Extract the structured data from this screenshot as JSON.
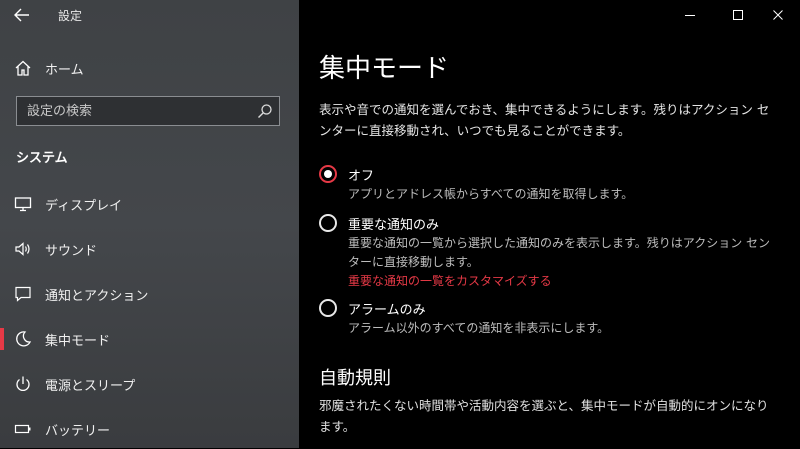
{
  "window": {
    "title": "設定",
    "controls": [
      "minimize",
      "maximize",
      "close"
    ]
  },
  "sidebar": {
    "home_label": "ホーム",
    "search_placeholder": "設定の検索",
    "section_title": "システム",
    "items": [
      {
        "label": "ディスプレイ",
        "icon": "monitor-icon"
      },
      {
        "label": "サウンド",
        "icon": "speaker-icon"
      },
      {
        "label": "通知とアクション",
        "icon": "notification-icon"
      },
      {
        "label": "集中モード",
        "icon": "moon-icon",
        "active": true
      },
      {
        "label": "電源とスリープ",
        "icon": "power-icon"
      },
      {
        "label": "バッテリー",
        "icon": "battery-icon"
      }
    ]
  },
  "main": {
    "title": "集中モード",
    "description": "表示や音での通知を選んでおき、集中できるようにします。残りはアクション センターに直接移動され、いつでも見ることができます。",
    "options": [
      {
        "label": "オフ",
        "sub": "アプリとアドレス帳からすべての通知を取得します。",
        "checked": true
      },
      {
        "label": "重要な通知のみ",
        "sub": "重要な通知の一覧から選択した通知のみを表示します。残りはアクション センターに直接移動します。",
        "link": "重要な通知の一覧をカスタマイズする",
        "checked": false
      },
      {
        "label": "アラームのみ",
        "sub": "アラーム以外のすべての通知を非表示にします。",
        "checked": false
      }
    ],
    "auto_rules_title": "自動規則",
    "auto_rules_desc": "邪魔されたくない時間帯や活動内容を選ぶと、集中モードが自動的にオンになります。"
  },
  "colors": {
    "accent": "#e63946",
    "sidebar_bg": "#404346",
    "main_bg": "#000000"
  }
}
